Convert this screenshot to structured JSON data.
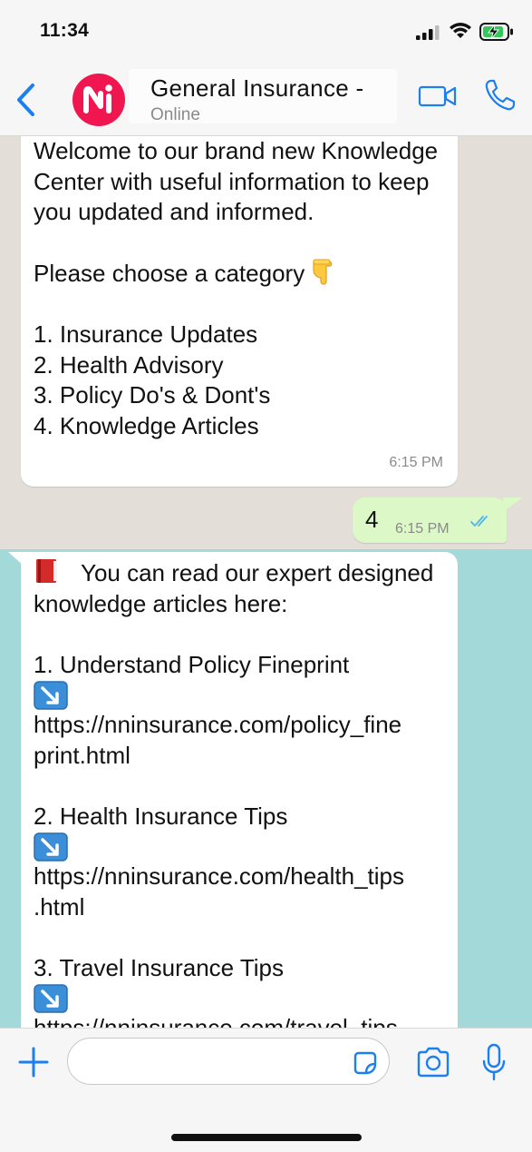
{
  "status_bar": {
    "time": "11:34"
  },
  "header": {
    "contact_name": "General Insurance -",
    "contact_status": "Online"
  },
  "colors": {
    "accent": "#1a7ff0",
    "avatar_bg": "#f0164f",
    "chat_bg": "#e3ded8",
    "teal_bg": "#a3d9d9",
    "outgoing_bubble": "#dcf8c6",
    "read_ticks": "#4fb6ec"
  },
  "messages": [
    {
      "direction": "incoming",
      "intro": "Welcome to our brand new Knowledge Center with useful information to keep you updated and informed.",
      "prompt": "Please choose a category",
      "prompt_emoji": "backhand-index-pointing-down",
      "options": [
        "1. Insurance Updates",
        "2. Health Advisory",
        "3. Policy Do's & Dont's",
        "4. Knowledge Articles"
      ],
      "time": "6:15 PM"
    },
    {
      "direction": "outgoing",
      "text": "4",
      "time": "6:15 PM",
      "status": "read"
    },
    {
      "direction": "incoming",
      "lead_emoji": "red-book",
      "intro": "You can read our expert designed knowledge articles here:",
      "arrow_emoji": "down-right-arrow",
      "articles": [
        {
          "title": "1. Understand Policy Fineprint",
          "url_part1": "https://nninsurance.com/policy_fine",
          "url_part2": "print.html"
        },
        {
          "title": "2. Health Insurance Tips",
          "url_part1": "https://nninsurance.com/health_tips",
          "url_part2": ".html"
        },
        {
          "title": "3. Travel Insurance Tips",
          "url_part1": "https://nninsurance.com/travel_tips",
          "url_part2": ""
        }
      ]
    }
  ],
  "input": {
    "placeholder": ""
  }
}
